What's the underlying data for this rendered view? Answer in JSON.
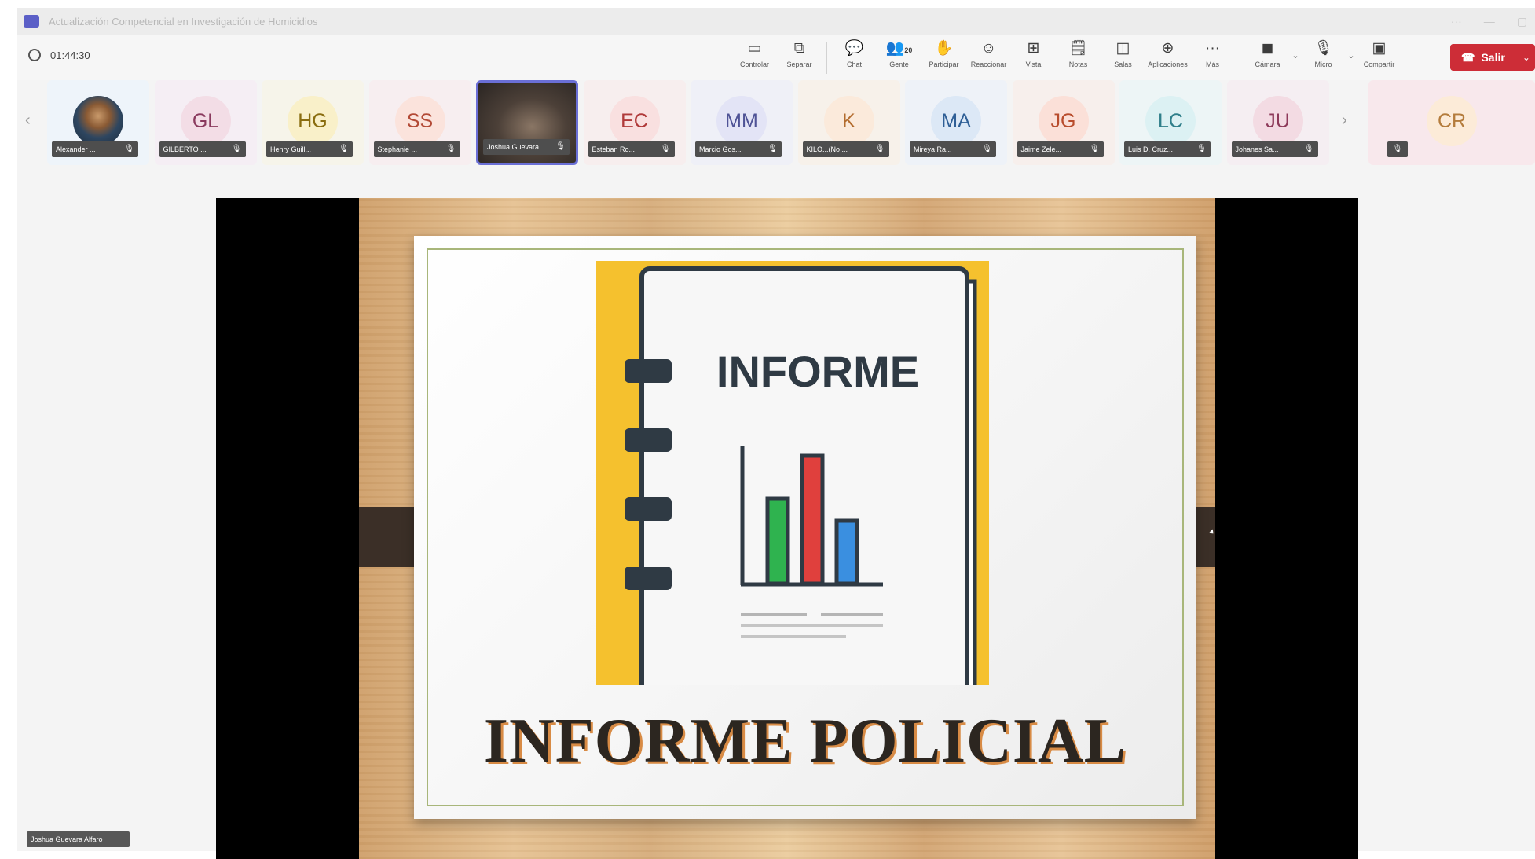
{
  "window": {
    "title": "Actualización Competencial en Investigación de Homicidios",
    "controls": [
      "···",
      "—",
      "▢"
    ]
  },
  "toolbar": {
    "timer": "01:44:30",
    "tools": [
      {
        "icon": "control-icon",
        "label": "Controlar",
        "glyph": "▭"
      },
      {
        "icon": "detach-icon",
        "label": "Separar",
        "glyph": "⧉"
      },
      {
        "icon": "chat-icon",
        "label": "Chat",
        "glyph": "💬"
      },
      {
        "icon": "people-icon",
        "label": "Gente",
        "glyph": "👥",
        "badge": "20"
      },
      {
        "icon": "raise-hand-icon",
        "label": "Participar",
        "glyph": "✋"
      },
      {
        "icon": "react-icon",
        "label": "Reaccionar",
        "glyph": "☺"
      },
      {
        "icon": "view-icon",
        "label": "Vista",
        "glyph": "⊞"
      },
      {
        "icon": "notes-icon",
        "label": "Notas",
        "glyph": "🗒"
      },
      {
        "icon": "rooms-icon",
        "label": "Salas",
        "glyph": "◫"
      },
      {
        "icon": "apps-icon",
        "label": "Aplicaciones",
        "glyph": "⊕"
      },
      {
        "icon": "more-icon",
        "label": "Más",
        "glyph": "···"
      }
    ],
    "media": [
      {
        "icon": "camera-off-icon",
        "label": "Cámara",
        "glyph": "◼"
      },
      {
        "icon": "mic-off-icon",
        "label": "Micro",
        "glyph": "🎙"
      },
      {
        "icon": "share-icon",
        "label": "Compartir",
        "glyph": "▣"
      }
    ],
    "leave_label": "Salir"
  },
  "participants": [
    {
      "initials": "",
      "name": "Alexander ...",
      "photo": true
    },
    {
      "initials": "GL",
      "name": "GILBERTO ...",
      "bg": "#f3dde6",
      "fg": "#8a3a5e"
    },
    {
      "initials": "HG",
      "name": "Henry Guill...",
      "bg": "#f9f0c9",
      "fg": "#8a6d10"
    },
    {
      "initials": "SS",
      "name": "Stephanie ...",
      "bg": "#fbe3dc",
      "fg": "#b34a36"
    },
    {
      "initials": "",
      "name": "Joshua Guevara...",
      "video": true
    },
    {
      "initials": "EC",
      "name": "Esteban Ro...",
      "bg": "#f9e0e0",
      "fg": "#b03a3a"
    },
    {
      "initials": "MM",
      "name": "Marcio Gos...",
      "bg": "#e3e4f6",
      "fg": "#4f5396"
    },
    {
      "initials": "K",
      "name": "KILO...(No ...",
      "bg": "#fbeadb",
      "fg": "#b36c2e"
    },
    {
      "initials": "MA",
      "name": "Mireya Ra...",
      "bg": "#dce8f6",
      "fg": "#2f5f96"
    },
    {
      "initials": "JG",
      "name": "Jaime Zele...",
      "bg": "#fbe0d8",
      "fg": "#b84c2c"
    },
    {
      "initials": "LC",
      "name": "Luis D. Cruz...",
      "bg": "#dcf1f3",
      "fg": "#2f7f8a"
    },
    {
      "initials": "JU",
      "name": "Johanes Sa...",
      "bg": "#f3dbe3",
      "fg": "#8d3a5a"
    }
  ],
  "extra_participant": {
    "initials": "CR",
    "name": ""
  },
  "nav": {
    "prev": "‹",
    "next": "›"
  },
  "slide": {
    "notebook_title": "INFORME",
    "caption": "INFORME POLICIAL"
  },
  "self_label": "Joshua Guevara Alfaro"
}
